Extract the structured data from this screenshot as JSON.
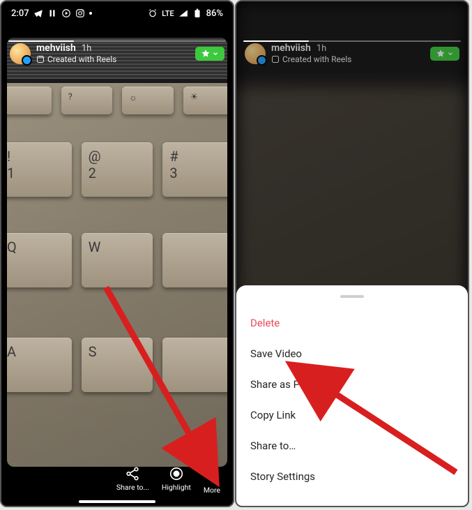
{
  "status": {
    "time": "2:07",
    "network_label": "LTE",
    "battery_text": "86%"
  },
  "story": {
    "username": "mehviish",
    "timeago": "1h",
    "created_label": "Created with Reels"
  },
  "bottom_bar": {
    "share_label": "Share to...",
    "highlight_label": "Highlight",
    "more_label": "More"
  },
  "sheet": {
    "delete": "Delete",
    "save_video": "Save Video",
    "share_as_post": "Share as Post…",
    "copy_link": "Copy Link",
    "share_to": "Share to…",
    "story_settings": "Story Settings"
  }
}
